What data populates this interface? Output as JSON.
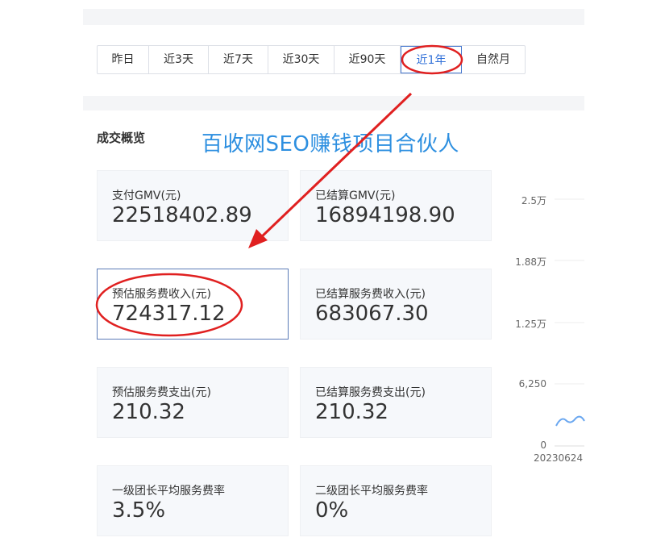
{
  "tabs": [
    {
      "label": "昨日",
      "active": false
    },
    {
      "label": "近3天",
      "active": false
    },
    {
      "label": "近7天",
      "active": false
    },
    {
      "label": "近30天",
      "active": false
    },
    {
      "label": "近90天",
      "active": false
    },
    {
      "label": "近1年",
      "active": true
    },
    {
      "label": "自然月",
      "active": false
    }
  ],
  "section_title": "成交概览",
  "watermark": "百收网SEO赚钱项目合伙人",
  "cards": [
    {
      "label": "支付GMV(元)",
      "value": "22518402.89"
    },
    {
      "label": "已结算GMV(元)",
      "value": "16894198.90"
    },
    {
      "label": "预估服务费收入(元)",
      "value": "724317.12"
    },
    {
      "label": "已结算服务费收入(元)",
      "value": "683067.30"
    },
    {
      "label": "预估服务费支出(元)",
      "value": "210.32"
    },
    {
      "label": "已结算服务费支出(元)",
      "value": "210.32"
    },
    {
      "label": "一级团长平均服务费率",
      "value": "3.5%"
    },
    {
      "label": "二级团长平均服务费率",
      "value": "0%"
    }
  ],
  "chart": {
    "y_ticks": [
      "2.5万",
      "1.88万",
      "1.25万",
      "6,250",
      "0"
    ],
    "x_ticks": [
      "20230624"
    ]
  },
  "colors": {
    "accent": "#2f6fd8",
    "annotation": "#e02020",
    "watermark": "#2d8fe0",
    "line": "#6aa7f0"
  }
}
